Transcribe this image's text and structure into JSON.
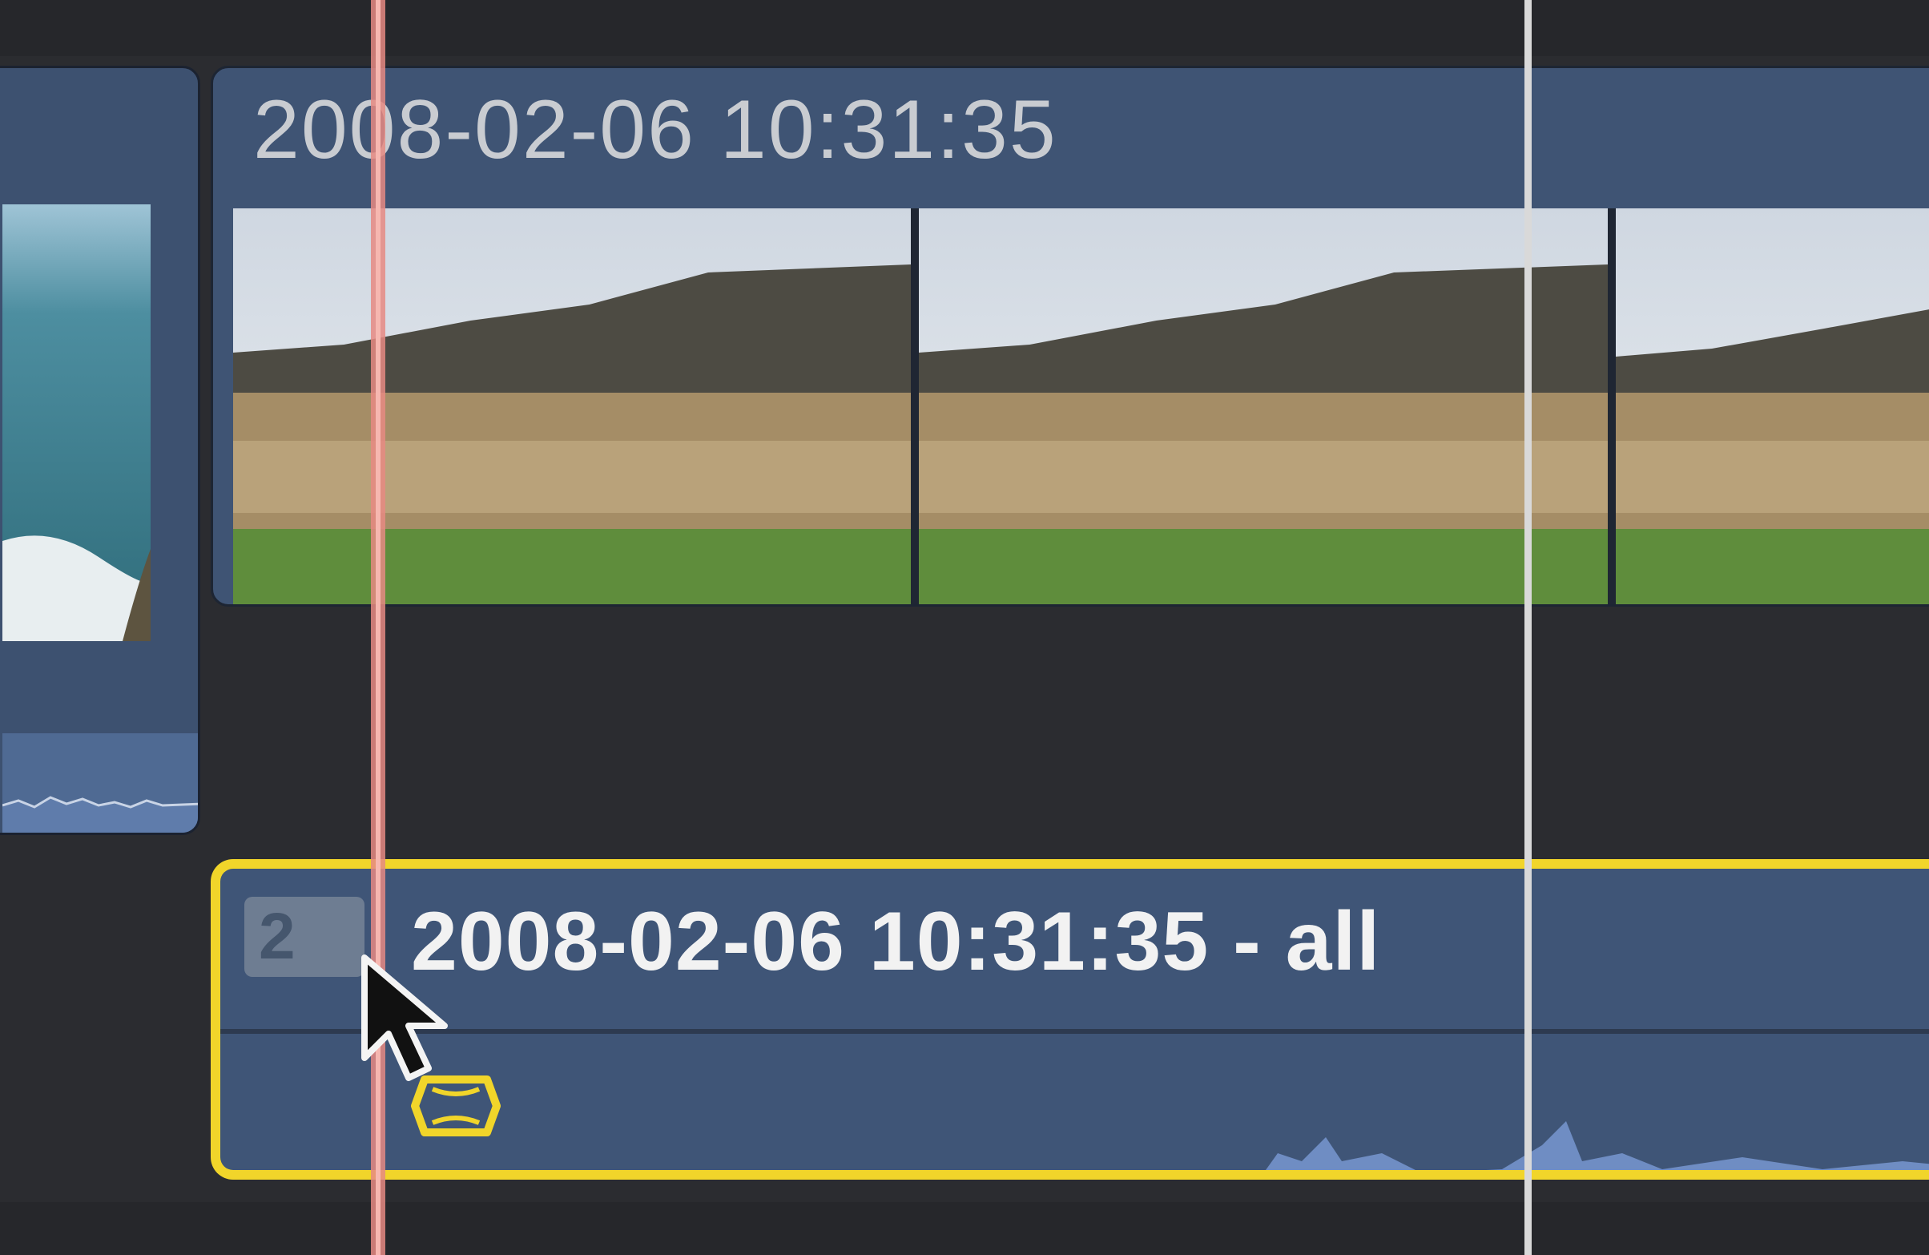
{
  "timeline": {
    "primary_clip": {
      "title": "2008-02-06 10:31:35"
    },
    "audio_clip": {
      "title": "2008-02-06 10:31:35 - all",
      "badge": "2"
    }
  }
}
